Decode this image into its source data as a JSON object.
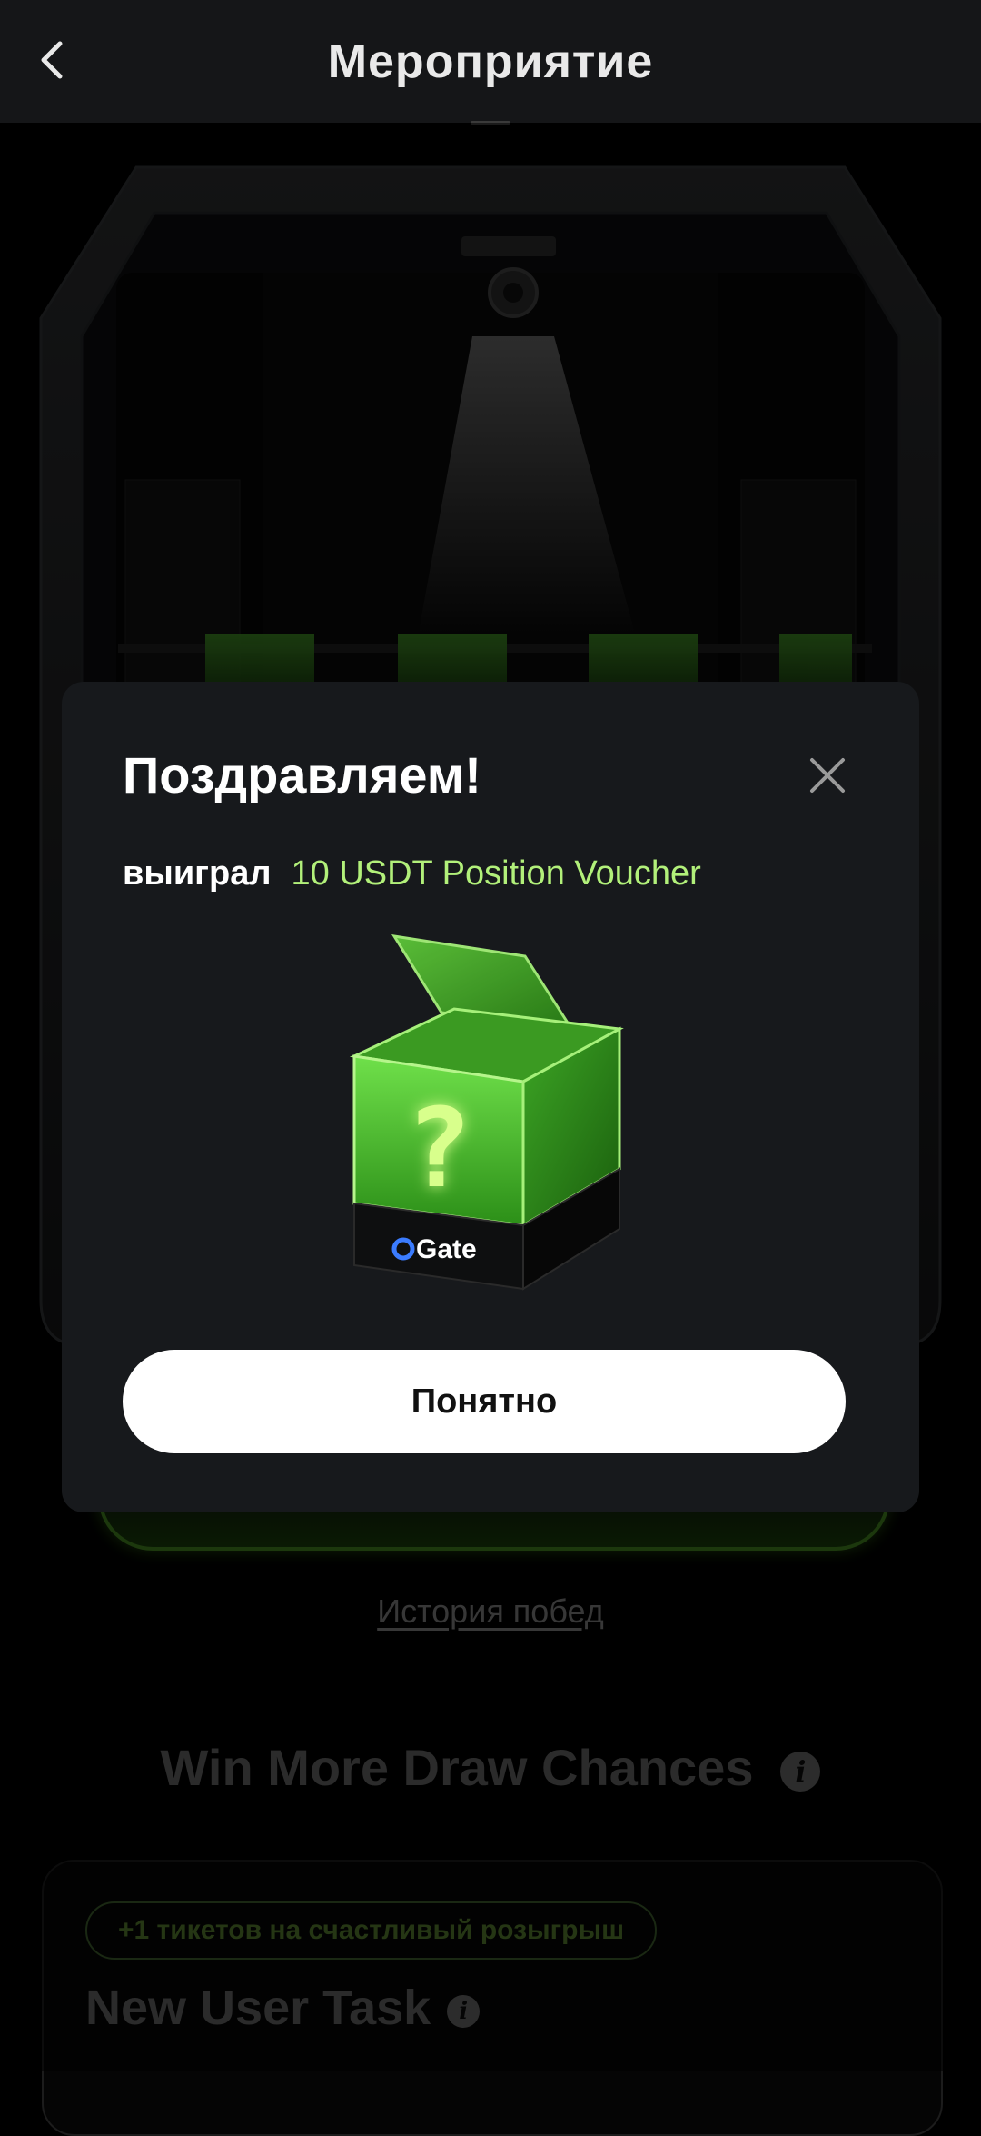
{
  "header": {
    "title": "Мероприятие"
  },
  "page": {
    "history_link": "История побед",
    "section_title": "Win More Draw Chances",
    "task": {
      "ticket_badge": "+1 тикетов на счастливый розыгрыш",
      "title": "New User Task"
    }
  },
  "modal": {
    "title": "Поздравляем!",
    "prize_label": "выиграл",
    "prize_value": "10 USDT Position Voucher",
    "box_brand": "Gate",
    "box_symbol": "?",
    "confirm_label": "Понятно"
  },
  "colors": {
    "accent_green": "#b2f07a",
    "modal_bg": "#17191c",
    "header_bg": "#151618"
  }
}
